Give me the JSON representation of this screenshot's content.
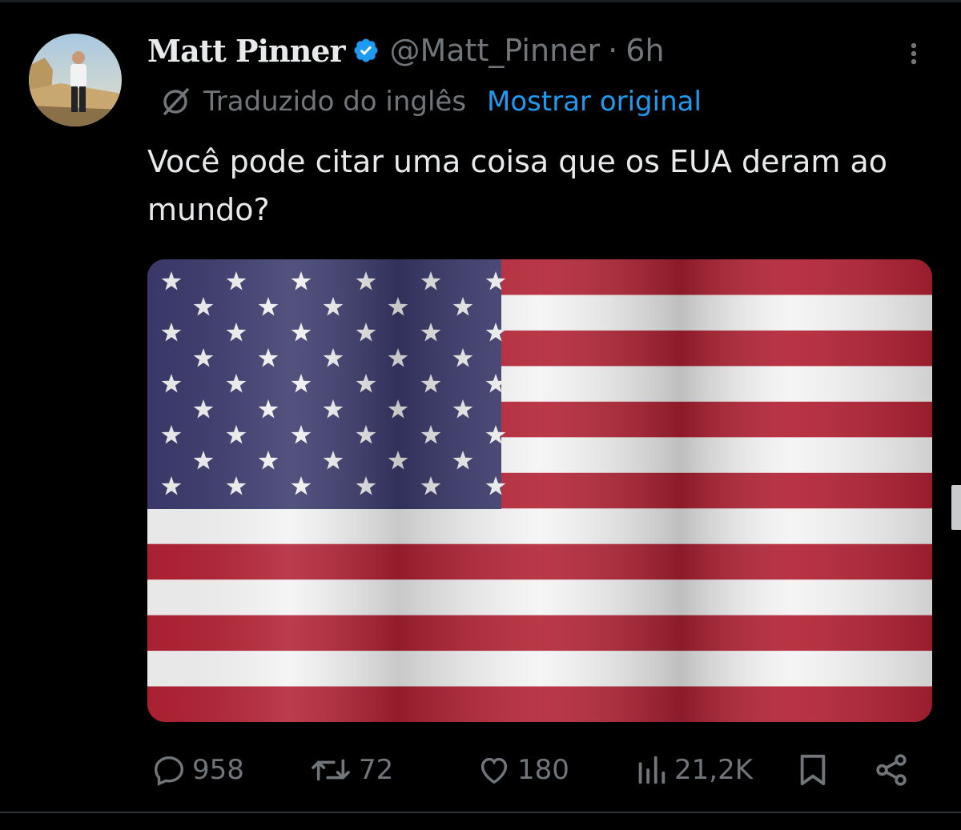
{
  "tweet": {
    "author_name": "Matt Pinner",
    "handle": "@Matt_Pinner",
    "separator": "·",
    "time": "6h",
    "translated_label": "Traduzido do inglês",
    "show_original_label": "Mostrar original",
    "text": "Você pode citar uma coisa que os EUA deram ao mundo?",
    "media_description_icon": "us-flag-image"
  },
  "actions": {
    "replies": "958",
    "retweets": "72",
    "likes": "180",
    "views": "21,2K"
  },
  "icons": [
    "verified-badge-icon",
    "more-options-icon",
    "translate-icon",
    "reply-icon",
    "retweet-icon",
    "like-icon",
    "views-icon",
    "bookmark-icon",
    "share-icon"
  ],
  "colors": {
    "background": "#000000",
    "text": "#e7e9ea",
    "secondary": "#71767b",
    "accent": "#1d9bf0",
    "flag_red": "#b22234",
    "flag_blue": "#3c3b6e"
  }
}
